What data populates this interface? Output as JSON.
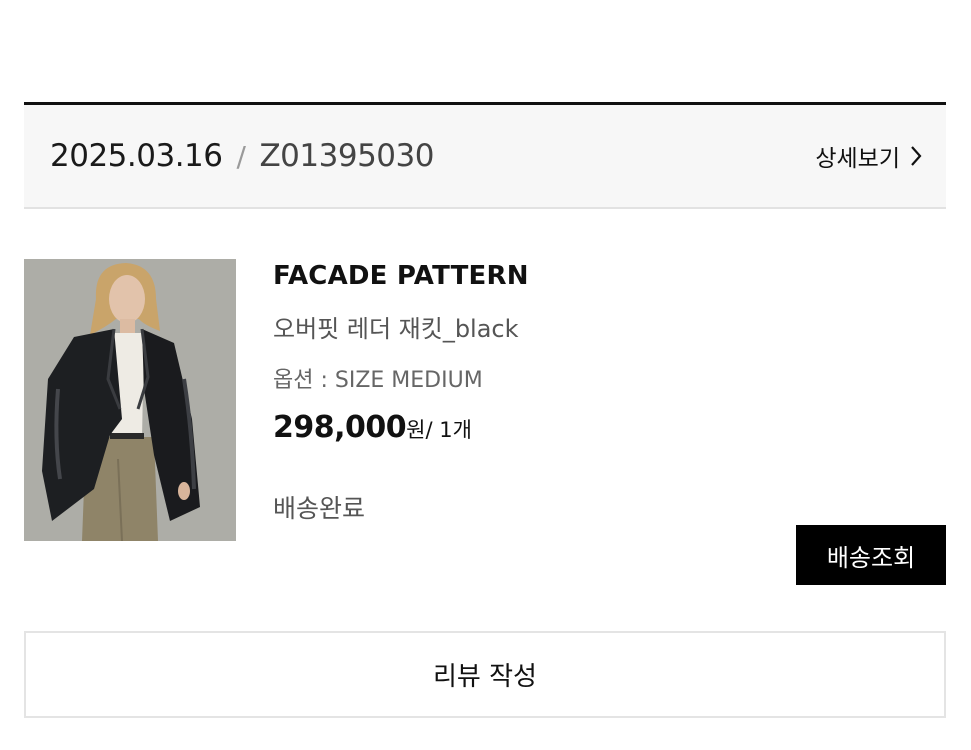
{
  "order": {
    "date": "2025.03.16",
    "separator": "/",
    "number": "Z01395030",
    "detail_label": "상세보기"
  },
  "product": {
    "brand": "FACADE PATTERN",
    "name": "오버핏 레더 재킷_black",
    "option": "옵션 : SIZE MEDIUM",
    "price": "298,000",
    "price_unit": "원",
    "quantity": "/ 1개",
    "status": "배송완료",
    "image_icon": "product-photo-leather-jacket"
  },
  "actions": {
    "track_label": "배송조회",
    "review_label": "리뷰 작성"
  }
}
